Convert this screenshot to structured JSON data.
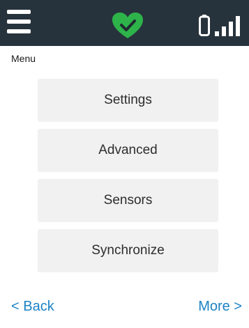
{
  "header": {
    "menu_label": "Menu",
    "status_color": "#2db34a",
    "icons": [
      "hamburger-menu-icon",
      "heart-check-icon",
      "battery-icon",
      "signal-bars-icon"
    ]
  },
  "menu": {
    "items": [
      {
        "label": "Settings"
      },
      {
        "label": "Advanced"
      },
      {
        "label": "Sensors"
      },
      {
        "label": "Synchronize"
      }
    ]
  },
  "footer": {
    "back_label": "< Back",
    "more_label": "More >"
  },
  "colors": {
    "topbar": "#27333c",
    "link": "#1c82c4",
    "button_bg": "#f1f1f1"
  }
}
